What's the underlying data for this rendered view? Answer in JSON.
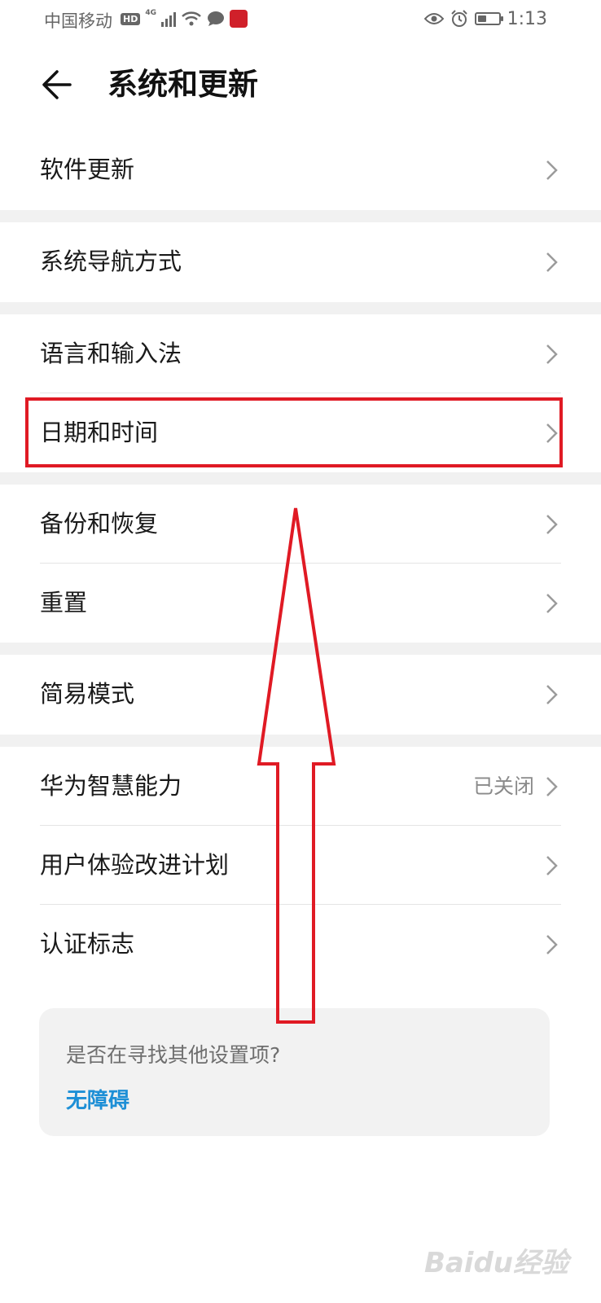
{
  "status_bar": {
    "carrier": "中国移动",
    "hd": "HD",
    "network": "4G",
    "time": "1:13",
    "battery_level": 0.45
  },
  "header": {
    "title": "系统和更新",
    "back_icon": "arrow-left-icon"
  },
  "groups": [
    {
      "items": [
        {
          "label": "软件更新"
        }
      ]
    },
    {
      "items": [
        {
          "label": "系统导航方式"
        }
      ]
    },
    {
      "items": [
        {
          "label": "语言和输入法"
        },
        {
          "label": "日期和时间"
        }
      ]
    },
    {
      "items": [
        {
          "label": "备份和恢复"
        },
        {
          "label": "重置"
        }
      ]
    },
    {
      "items": [
        {
          "label": "简易模式"
        }
      ]
    },
    {
      "items": [
        {
          "label": "华为智慧能力",
          "value": "已关闭"
        },
        {
          "label": "用户体验改进计划"
        },
        {
          "label": "认证标志"
        }
      ]
    }
  ],
  "search_card": {
    "question": "是否在寻找其他设置项?",
    "link": "无障碍"
  },
  "watermark": "Baidu经验",
  "colors": {
    "annotation": "#e01a24",
    "link": "#1d8fd6",
    "separator": "#f1f1f1"
  }
}
